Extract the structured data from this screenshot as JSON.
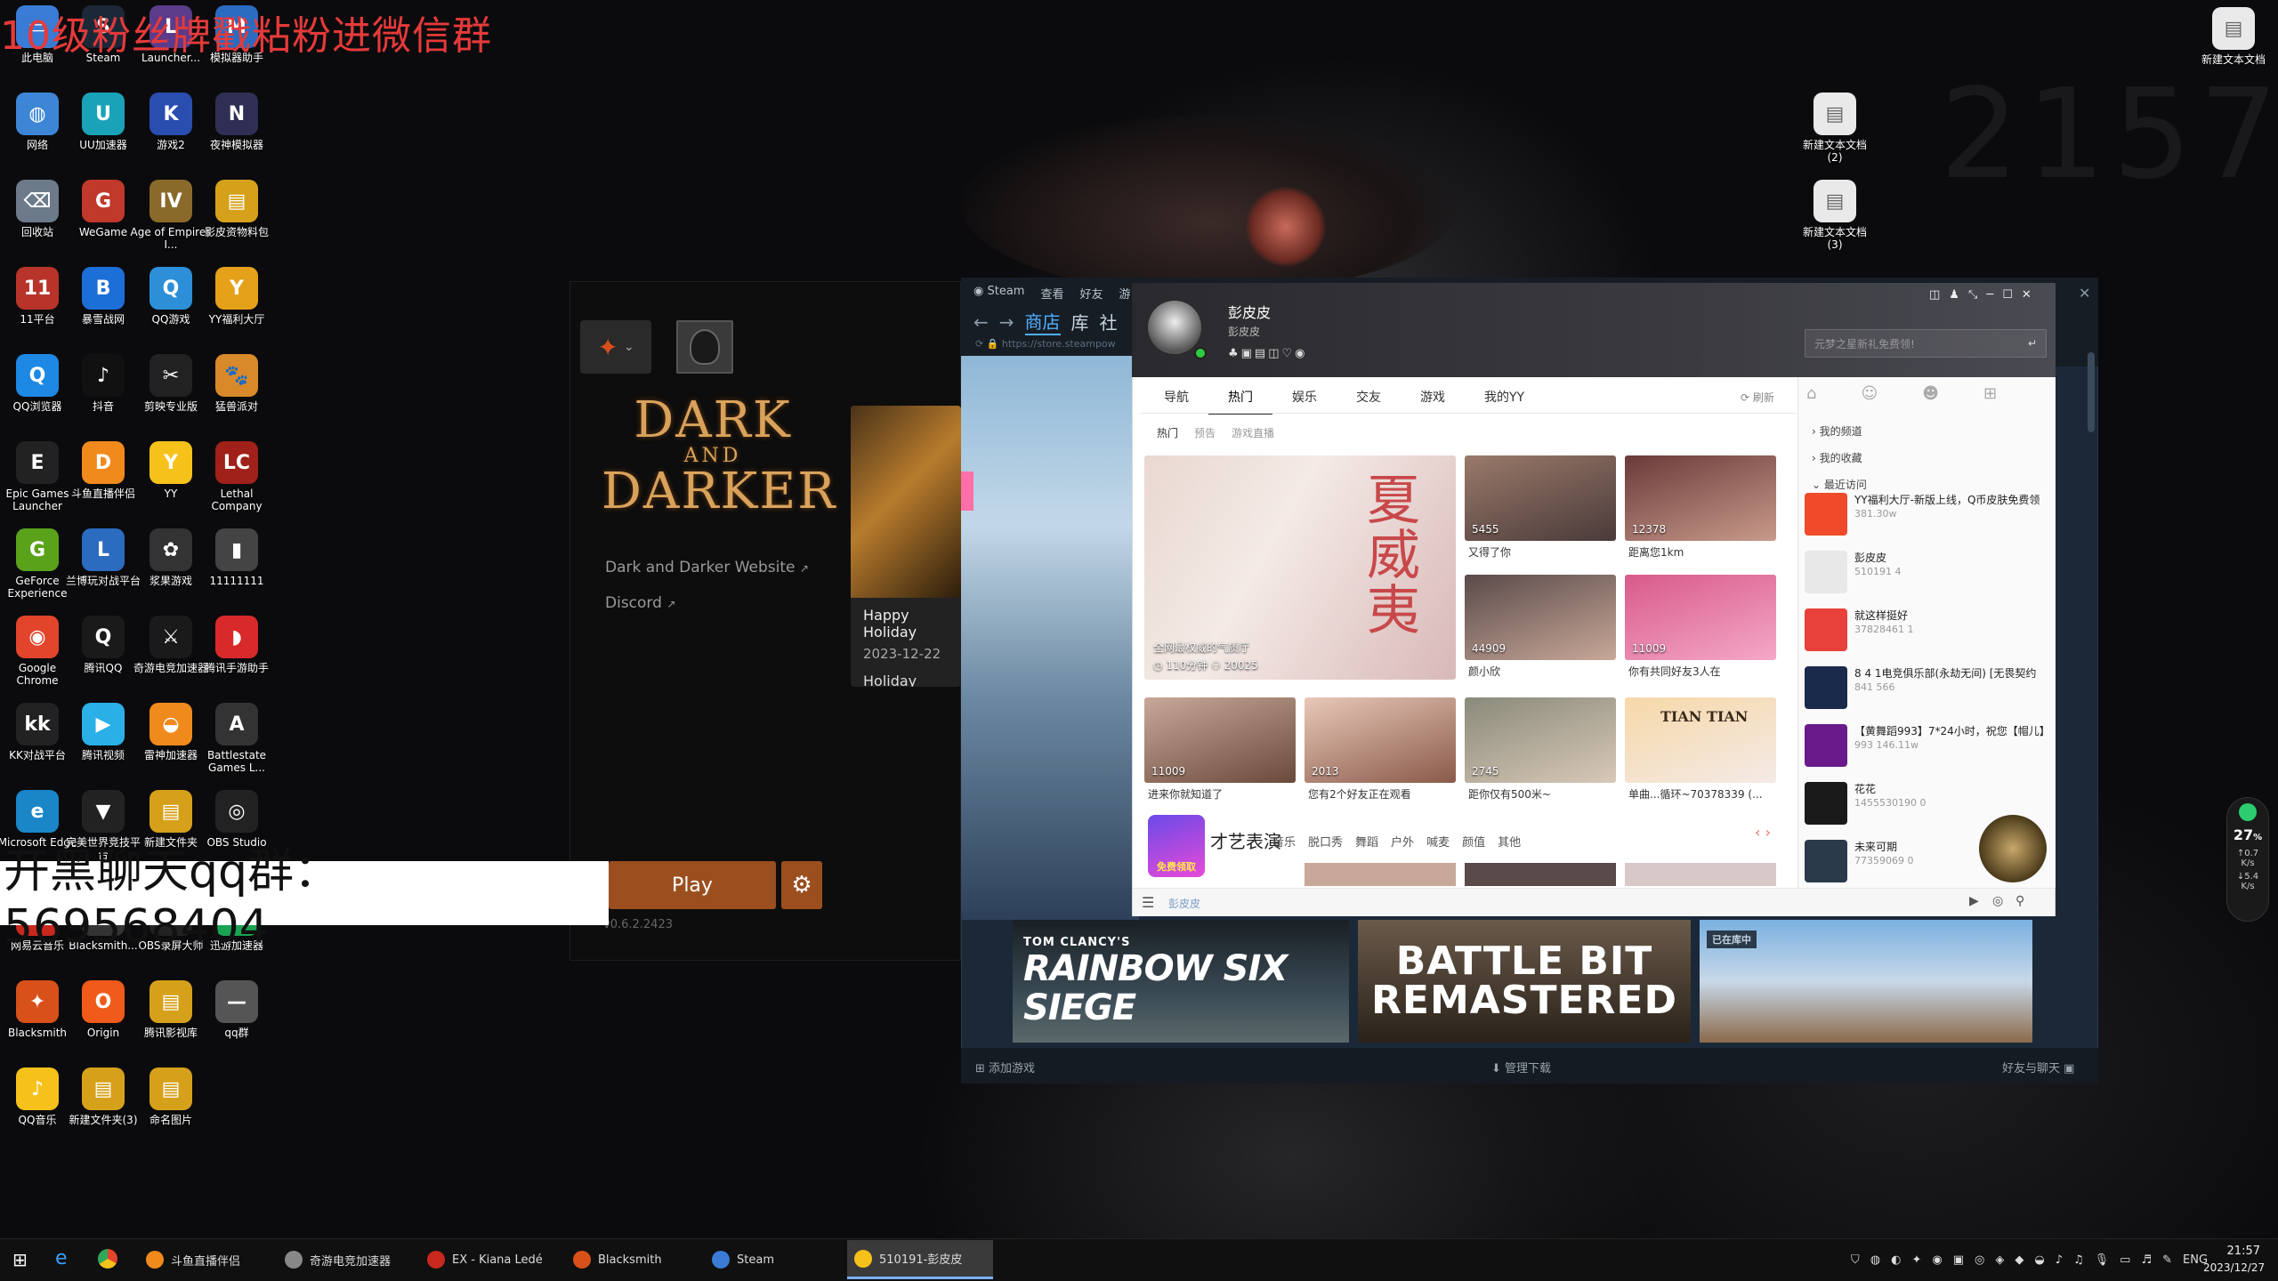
{
  "overlay": {
    "top_text": "10级粉丝牌戳粘粉进微信群",
    "qq_group_text": "开黑聊天qq群：  569568404",
    "clock_bg": "2157"
  },
  "desktop_icons": [
    {
      "label": "此电脑",
      "color": "#3a7bd5",
      "glyph": "▭"
    },
    {
      "label": "Steam",
      "color": "#1b2838",
      "glyph": "S"
    },
    {
      "label": "Launcher...",
      "color": "#5b3b8a",
      "glyph": "L"
    },
    {
      "label": "模拟器助手",
      "color": "#2b6bc0",
      "glyph": "M"
    },
    {
      "label": "网络",
      "color": "#3d86d6",
      "glyph": "◍"
    },
    {
      "label": "UU加速器",
      "color": "#1aa3b8",
      "glyph": "U"
    },
    {
      "label": "游戏2",
      "color": "#2a4db0",
      "glyph": "K"
    },
    {
      "label": "夜神模拟器",
      "color": "#2f2f55",
      "glyph": "N"
    },
    {
      "label": "回收站",
      "color": "#6c7a89",
      "glyph": "⌫"
    },
    {
      "label": "WeGame",
      "color": "#c0392b",
      "glyph": "G"
    },
    {
      "label": "Age of Empires I...",
      "color": "#8a6a2a",
      "glyph": "IV"
    },
    {
      "label": "影皮资物料包",
      "color": "#d6a11a",
      "glyph": "▤"
    },
    {
      "label": "11平台",
      "color": "#b8342a",
      "glyph": "11"
    },
    {
      "label": "暴雪战网",
      "color": "#1d6fd8",
      "glyph": "B"
    },
    {
      "label": "QQ游戏",
      "color": "#2d8fd8",
      "glyph": "Q"
    },
    {
      "label": "YY福利大厅",
      "color": "#e6a11a",
      "glyph": "Y"
    },
    {
      "label": "QQ浏览器",
      "color": "#1e88e5",
      "glyph": "Q"
    },
    {
      "label": "抖音",
      "color": "#111111",
      "glyph": "♪"
    },
    {
      "label": "剪映专业版",
      "color": "#222222",
      "glyph": "✂"
    },
    {
      "label": "猛兽派对",
      "color": "#d8892a",
      "glyph": "🐾"
    },
    {
      "label": "Epic Games Launcher",
      "color": "#222222",
      "glyph": "E"
    },
    {
      "label": "斗鱼直播伴侣",
      "color": "#f08a1c",
      "glyph": "D"
    },
    {
      "label": "YY",
      "color": "#f6c21a",
      "glyph": "Y"
    },
    {
      "label": "Lethal Company",
      "color": "#a0201a",
      "glyph": "LC"
    },
    {
      "label": "GeForce Experience",
      "color": "#5aa21a",
      "glyph": "G"
    },
    {
      "label": "兰博玩对战平台",
      "color": "#2b6bc0",
      "glyph": "L"
    },
    {
      "label": "浆果游戏",
      "color": "#333333",
      "glyph": "✿"
    },
    {
      "label": "11111111",
      "color": "#444444",
      "glyph": "▮"
    },
    {
      "label": "Google Chrome",
      "color": "#e2452c",
      "glyph": "◉"
    },
    {
      "label": "腾讯QQ",
      "color": "#1a1a1a",
      "glyph": "Q"
    },
    {
      "label": "奇游电竞加速器",
      "color": "#1a1a1a",
      "glyph": "⚔"
    },
    {
      "label": "腾讯手游助手",
      "color": "#d82a2a",
      "glyph": "◗"
    },
    {
      "label": "KK对战平台",
      "color": "#222222",
      "glyph": "kk"
    },
    {
      "label": "腾讯视频",
      "color": "#2ab0e6",
      "glyph": "▶"
    },
    {
      "label": "雷神加速器",
      "color": "#f08a1c",
      "glyph": "◒"
    },
    {
      "label": "Battlestate Games L...",
      "color": "#333333",
      "glyph": "A"
    },
    {
      "label": "Microsoft Edge",
      "color": "#1a86c8",
      "glyph": "e"
    },
    {
      "label": "完美世界竞技平台",
      "color": "#222222",
      "glyph": "▼"
    },
    {
      "label": "新建文件夹",
      "color": "#d6a11a",
      "glyph": "▤"
    },
    {
      "label": "OBS Studio",
      "color": "#222222",
      "glyph": "◎"
    },
    {
      "label": "网易云音乐",
      "color": "#c8281e",
      "glyph": "♫"
    },
    {
      "label": "Blacksmith...",
      "color": "#333333",
      "glyph": "B"
    },
    {
      "label": "OBS录屏大师",
      "color": "#222222",
      "glyph": "◎"
    },
    {
      "label": "迅游加速器",
      "color": "#1aa352",
      "glyph": "X"
    },
    {
      "label": "Blacksmith",
      "color": "#d8501a",
      "glyph": "✦"
    },
    {
      "label": "Origin",
      "color": "#f05a1a",
      "glyph": "O"
    },
    {
      "label": "腾讯影视库",
      "color": "#d6a11a",
      "glyph": "▤"
    },
    {
      "label": "qq群",
      "color": "#555555",
      "glyph": "—"
    },
    {
      "label": "QQ音乐",
      "color": "#f6c21a",
      "glyph": "♪"
    },
    {
      "label": "新建文件夹(3)",
      "color": "#d6a11a",
      "glyph": "▤"
    },
    {
      "label": "命名图片",
      "color": "#d6a11a",
      "glyph": "▤"
    }
  ],
  "right_icons": [
    {
      "label": "新建文本文档"
    },
    {
      "label": "新建文本文档 (2)"
    },
    {
      "label": "新建文本文档 (3)"
    }
  ],
  "dad": {
    "logo_line1": "DARK",
    "logo_line2": "AND",
    "logo_line3": "DARKER",
    "website": "Dark and Darker Website",
    "discord": "Discord",
    "news_title": "Happy Holiday",
    "news_date": "2023-12-22",
    "news_sale": "Holiday Sale!",
    "play": "Play",
    "version": "v0.6.2.2423"
  },
  "steam": {
    "menu": [
      "Steam",
      "查看",
      "好友",
      "游"
    ],
    "nav": [
      "商店",
      "库",
      "社"
    ],
    "url": "https://store.steampow",
    "add_game": "添加游戏",
    "manage_downloads": "管理下载",
    "friends_chat": "好友与聊天",
    "banners": [
      "RAINBOW SIX SIEGE",
      "BATTLE BIT REMASTERED",
      ""
    ],
    "banner_brand": "TOM CLANCY'S",
    "banner_badge": "已在库中"
  },
  "yy": {
    "name": "彭皮皮",
    "subname": "彭皮皮",
    "search_placeholder": "元梦之星新礼免费领!",
    "tabs": [
      "导航",
      "热门",
      "娱乐",
      "交友",
      "游戏",
      "我的YY"
    ],
    "active_tab": "热门",
    "refresh": "刷新",
    "subtabs": [
      "热门",
      "预告",
      "游戏直播"
    ],
    "big_thumb": {
      "caption": "全网最权威的气质厅",
      "time": "110分钟",
      "count": "20025",
      "text": "夏 威 夷"
    },
    "thumbs": [
      {
        "count": "5455",
        "caption": "又得了你"
      },
      {
        "count": "12378",
        "caption": "距离您1km"
      },
      {
        "count": "44909",
        "caption": "颜小欣"
      },
      {
        "count": "11009",
        "caption": "你有共同好友3人在"
      },
      {
        "count": "11009",
        "caption": "进来你就知道了"
      },
      {
        "count": "2013",
        "caption": "您有2个好友正在观看"
      },
      {
        "count": "2745",
        "caption": "距你仅有500米~"
      },
      {
        "count": "",
        "caption": "单曲...循环~70378339 (..."
      }
    ],
    "thumb_badge": "TIAN TIAN",
    "section_title": "才艺表演",
    "section_tags": [
      "音乐",
      "脱口秀",
      "舞蹈",
      "户外",
      "喊麦",
      "颜值",
      "其他"
    ],
    "free_badge": "免费领取",
    "side_links": [
      "我的频道",
      "我的收藏",
      "最近访问"
    ],
    "side_items": [
      {
        "title": "YY福利大厅-新版上线，Q币皮肤免费领",
        "sub": "381.30w",
        "color": "#f04a2a"
      },
      {
        "title": "彭皮皮",
        "sub": "510191   4",
        "color": "#e8e8e8"
      },
      {
        "title": "就这样挺好",
        "sub": "37828461   1",
        "color": "#e8403a"
      },
      {
        "title": "8 4 1电竞俱乐部(永劫无间) [无畏契约",
        "sub": "841   566",
        "color": "#1a2a4a"
      },
      {
        "title": "【黄舞蹈993】7*24小时，祝您【帽儿】",
        "sub": "993   146.11w",
        "color": "#6a1a8a"
      },
      {
        "title": "花花",
        "sub": "1455530190   0",
        "color": "#1a1a1a"
      },
      {
        "title": "未来可期",
        "sub": "77359069   0",
        "color": "#2a3a4a"
      }
    ],
    "bottom_text": "彭皮皮"
  },
  "taskbar": {
    "apps": [
      {
        "label": "斗鱼直播伴侣",
        "color": "#f08a1c"
      },
      {
        "label": "奇游电竞加速器",
        "color": "#888888"
      },
      {
        "label": "EX - Kiana Ledé",
        "color": "#c8281e"
      },
      {
        "label": "Blacksmith",
        "color": "#d8501a"
      },
      {
        "label": "Steam",
        "color": "#3a7bd5"
      },
      {
        "label": "510191-彭皮皮",
        "color": "#f6c21a"
      }
    ],
    "lang": "ENG",
    "time": "21:57",
    "date": "2023/12/27"
  },
  "net": {
    "value": "27",
    "unit": "%",
    "up": "0.7",
    "down": "5.4",
    "kb": "K/s"
  }
}
